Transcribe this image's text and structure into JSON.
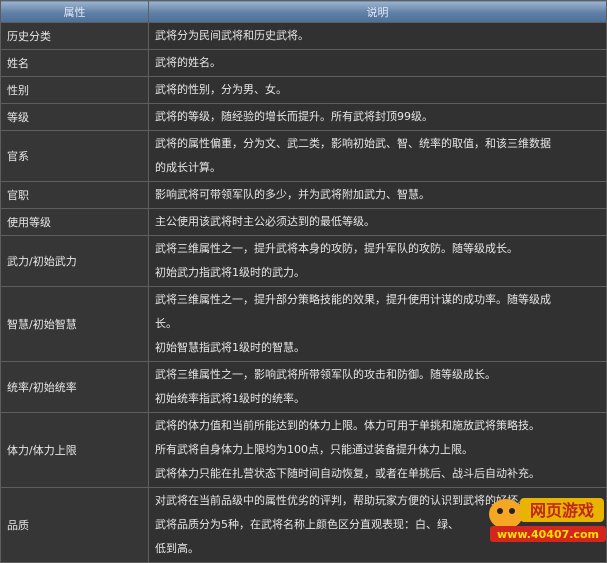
{
  "header": {
    "col1": "属性",
    "col2": "说明"
  },
  "rows": [
    {
      "name": "历史分类",
      "lines": [
        "武将分为民间武将和历史武将。"
      ]
    },
    {
      "name": "姓名",
      "lines": [
        "武将的姓名。"
      ]
    },
    {
      "name": "性别",
      "lines": [
        "武将的性别，分为男、女。"
      ]
    },
    {
      "name": "等级",
      "lines": [
        "武将的等级，随经验的增长而提升。所有武将封顶99级。"
      ]
    },
    {
      "name": "官系",
      "lines": [
        "武将的属性偏重，分为文、武二类，影响初始武、智、统率的取值，和该三维数据",
        "的成长计算。"
      ]
    },
    {
      "name": "官职",
      "lines": [
        "影响武将可带领军队的多少，并为武将附加武力、智慧。"
      ]
    },
    {
      "name": "使用等级",
      "lines": [
        "主公使用该武将时主公必须达到的最低等级。"
      ]
    },
    {
      "name": "武力/初始武力",
      "lines": [
        "武将三维属性之一，提升武将本身的攻防，提升军队的攻防。随等级成长。",
        "初始武力指武将1级时的武力。"
      ]
    },
    {
      "name": "智慧/初始智慧",
      "lines": [
        "武将三维属性之一，提升部分策略技能的效果，提升使用计谋的成功率。随等级成",
        "长。",
        "初始智慧指武将1级时的智慧。"
      ]
    },
    {
      "name": "统率/初始统率",
      "lines": [
        "武将三维属性之一，影响武将所带领军队的攻击和防御。随等级成长。",
        "初始统率指武将1级时的统率。"
      ]
    },
    {
      "name": "体力/体力上限",
      "lines": [
        "武将的体力值和当前所能达到的体力上限。体力可用于单挑和施放武将策略技。",
        "所有武将自身体力上限均为100点，只能通过装备提升体力上限。",
        "武将体力只能在扎营状态下随时间自动恢复，或者在单挑后、战斗后自动补充。"
      ]
    },
    {
      "name": "品质",
      "lines": [
        "对武将在当前品级中的属性优劣的评判，帮助玩家方便的认识到武将的好坏。",
        "武将品质分为5种，在武将名称上颜色区分直观表现：白、绿、",
        "低到高。"
      ]
    }
  ],
  "watermark": {
    "title": "网页游戏",
    "url": "www.40407.com"
  }
}
